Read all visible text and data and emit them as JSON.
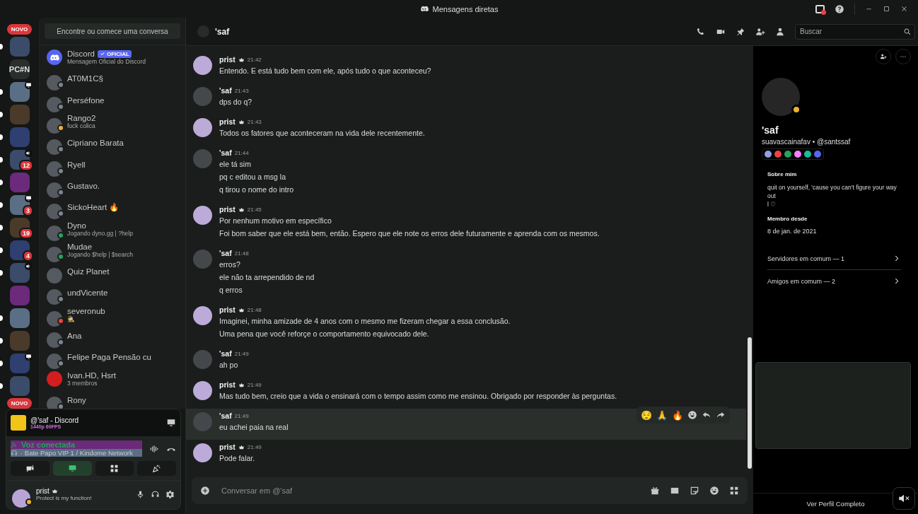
{
  "window": {
    "title": "Mensagens diretas"
  },
  "servers": [
    {
      "kind": "image",
      "unread": true,
      "voice": false,
      "screen": false
    },
    {
      "kind": "text",
      "label": "PC#N",
      "unread": false,
      "voice": false,
      "screen": false
    },
    {
      "kind": "image",
      "unread": true,
      "voice": false,
      "screen": true
    },
    {
      "kind": "image",
      "unread": true,
      "voice": false,
      "screen": false
    },
    {
      "kind": "image",
      "unread": true,
      "voice": false,
      "screen": false
    },
    {
      "kind": "image",
      "unread": true,
      "voice": true,
      "screen": false,
      "badge": "12"
    },
    {
      "kind": "image",
      "unread": true,
      "voice": false,
      "screen": false
    },
    {
      "kind": "image",
      "unread": true,
      "voice": false,
      "screen": true,
      "badge": "3"
    },
    {
      "kind": "image",
      "unread": true,
      "voice": false,
      "screen": false,
      "badge": "19"
    },
    {
      "kind": "image",
      "unread": true,
      "voice": false,
      "screen": false,
      "badge": "4"
    },
    {
      "kind": "image",
      "unread": true,
      "voice": true,
      "screen": false
    },
    {
      "kind": "image",
      "unread": false,
      "voice": false,
      "screen": false
    },
    {
      "kind": "image",
      "unread": true,
      "voice": false,
      "screen": false
    },
    {
      "kind": "image",
      "unread": true,
      "voice": false,
      "screen": false
    },
    {
      "kind": "image",
      "unread": true,
      "voice": false,
      "screen": true
    },
    {
      "kind": "image",
      "unread": true,
      "voice": false,
      "screen": false
    }
  ],
  "new_badges": [
    "NOVO",
    "NOVO"
  ],
  "dm_search": "Encontre ou comece uma conversa",
  "dms": [
    {
      "name": "Discord",
      "tag": "OFICIAL",
      "subtitle": "Mensagem Oficial do Discord",
      "kind": "logo"
    },
    {
      "name": "AT0M1C§",
      "color": "#80848e",
      "kind": "photo"
    },
    {
      "name": "Perséfone",
      "color": "#80848e",
      "kind": "photo"
    },
    {
      "name": "Rango2",
      "subtitle": "fuck colica",
      "color": "#f0b232",
      "kind": "photo"
    },
    {
      "name": "Cipriano Barata",
      "color": "#80848e",
      "kind": "photo"
    },
    {
      "name": "Ryell",
      "color": "#80848e",
      "kind": "photo"
    },
    {
      "name": "Gustavo.",
      "color": "#80848e",
      "kind": "photo"
    },
    {
      "name": "SickoHeart 🔥",
      "color": "#80848e",
      "kind": "photo"
    },
    {
      "name": "Dyno",
      "subtitle": "Jogando dyno.gg | ?help",
      "color": "#23a55a",
      "kind": "photo"
    },
    {
      "name": "Mudae",
      "subtitle": "Jogando $help | $search",
      "color": "#23a55a",
      "kind": "photo"
    },
    {
      "name": "Quiz Planet",
      "kind": "photo"
    },
    {
      "name": "undVicente",
      "color": "#80848e",
      "kind": "photo"
    },
    {
      "name": "severonub",
      "subtitle": "🕵",
      "color": "#f23f43",
      "kind": "photo"
    },
    {
      "name": "Ana",
      "color": "#80848e",
      "kind": "photo"
    },
    {
      "name": "Felipe Paga Pensão cu",
      "color": "#80848e",
      "kind": "photo"
    },
    {
      "name": "Ivan.HD, Hsrt",
      "subtitle": "3 membros",
      "kind": "group"
    },
    {
      "name": "Rony",
      "color": "#80848e",
      "kind": "photo"
    }
  ],
  "stream": {
    "title": "@'saf - Discord",
    "quality": "1440p 60FPS"
  },
  "voice": {
    "status": "Voz conectada",
    "channel": "· Bate Papo VIP 1 / Kindome Network"
  },
  "voice_buttons": [
    {
      "kind": "camera",
      "on": false
    },
    {
      "kind": "screen",
      "on": true
    },
    {
      "kind": "activities",
      "on": false
    },
    {
      "kind": "soundboard",
      "on": false
    }
  ],
  "user": {
    "name": "prist",
    "status": "Protect is my function!"
  },
  "chat": {
    "title": "'saf",
    "search": {
      "placeholder": "Buscar"
    },
    "input": {
      "placeholder": "Conversar em @'saf"
    }
  },
  "messages": [
    {
      "author": "prist",
      "owner": true,
      "time": "21:42",
      "highlighted": false,
      "lines": [
        "Entendo. E está tudo bem com ele, após tudo o que aconteceu?"
      ]
    },
    {
      "author": "'saf",
      "owner": false,
      "time": "21:43",
      "highlighted": false,
      "lines": [
        "dps do q?"
      ]
    },
    {
      "author": "prist",
      "owner": true,
      "time": "21:43",
      "highlighted": false,
      "lines": [
        "Todos os fatores que aconteceram na vida dele recentemente."
      ]
    },
    {
      "author": "'saf",
      "owner": false,
      "time": "21:44",
      "highlighted": false,
      "lines": [
        "ele tá sim",
        "pq c editou a msg la",
        "q tirou o nome do intro"
      ]
    },
    {
      "author": "prist",
      "owner": true,
      "time": "21:45",
      "highlighted": false,
      "lines": [
        "Por nenhum motivo em específico",
        "Foi bom saber que ele está bem, então. Espero que ele note os erros dele futuramente e aprenda com os mesmos."
      ]
    },
    {
      "author": "'saf",
      "owner": false,
      "time": "21:48",
      "highlighted": false,
      "lines": [
        "erros?",
        "ele não ta arrependido de nd",
        "q erros"
      ]
    },
    {
      "author": "prist",
      "owner": true,
      "time": "21:48",
      "highlighted": false,
      "lines": [
        "Imaginei, minha amizade de 4 anos com o mesmo me fizeram chegar a essa conclusão.",
        "Uma pena que você reforçe o comportamento equivocado dele."
      ]
    },
    {
      "author": "'saf",
      "owner": false,
      "time": "21:49",
      "highlighted": false,
      "lines": [
        "ah po"
      ]
    },
    {
      "author": "prist",
      "owner": true,
      "time": "21:49",
      "highlighted": false,
      "lines": [
        "Mas tudo bem, creio que a vida o ensinará com o tempo assim como me ensinou. Obrigado por responder às perguntas."
      ]
    },
    {
      "author": "'saf",
      "owner": false,
      "time": "21:49",
      "highlighted": true,
      "lines": [
        "eu achei paia na real"
      ]
    },
    {
      "author": "prist",
      "owner": true,
      "time": "21:49",
      "highlighted": false,
      "lines": [
        "Pode falar."
      ]
    }
  ],
  "hover_reactions": [
    "😌",
    "🙏",
    "🔥"
  ],
  "profile": {
    "display_name": "'saf",
    "handle": "suavascainafav • @santssaf",
    "status_dot": {
      "color": "#f0b232"
    },
    "about_title": "Sobre mim",
    "about": [
      "quit on yourself, 'cause you can't figure your way out",
      "l ♡"
    ],
    "member_title": "Membro desde",
    "member_since": "8 de jan. de 2021",
    "links": [
      "Servidores em comum — 1",
      "Amigos em comum — 2"
    ],
    "full_profile": "Ver Perfil Completo"
  }
}
